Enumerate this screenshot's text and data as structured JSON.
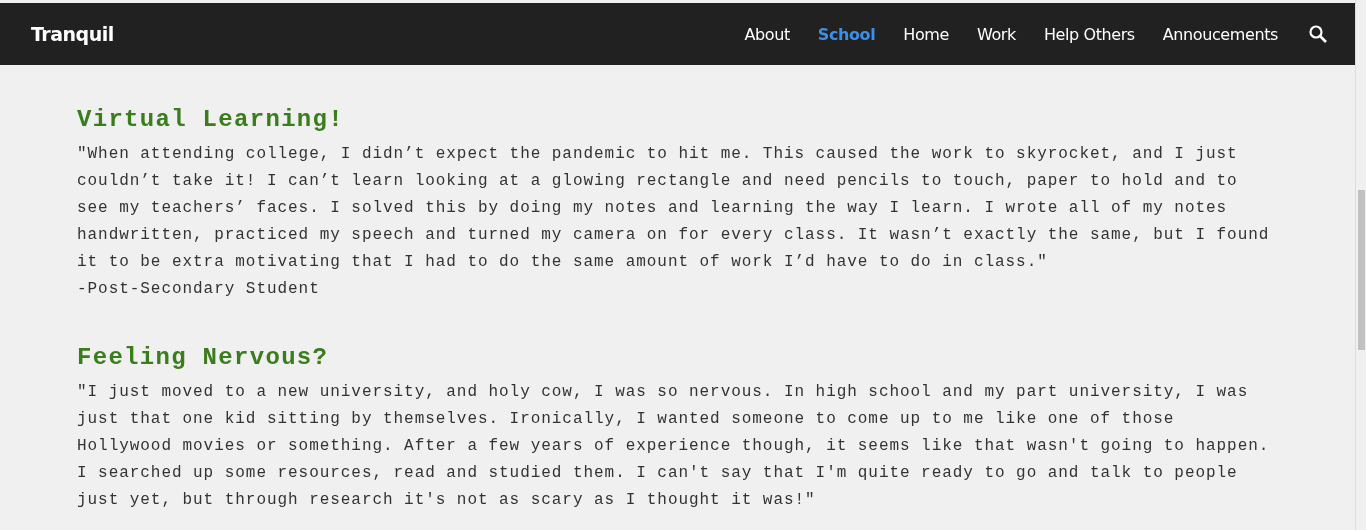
{
  "header": {
    "logo": "Tranquil",
    "nav": [
      {
        "label": "About",
        "selected": false
      },
      {
        "label": "School",
        "selected": true
      },
      {
        "label": "Home",
        "selected": false
      },
      {
        "label": "Work",
        "selected": false
      },
      {
        "label": "Help Others",
        "selected": false
      },
      {
        "label": "Annoucements",
        "selected": false
      }
    ]
  },
  "sections": [
    {
      "title": "Virtual Learning!",
      "quote_lines": [
        "\"When attending college, I didn’t expect the pandemic to hit me. This caused the work to skyrocket, and I just",
        "couldn’t take it! I can’t learn looking at a glowing rectangle and need pencils to touch, paper to hold and to",
        "see my teachers’ faces. I solved this by doing my notes and learning the way I learn. I wrote all of my notes",
        "handwritten, practiced my speech and turned my camera on for every class. It wasn’t exactly the same, but I found",
        "it to be extra motivating that I had to do the same amount of work I’d have to do in class.\""
      ],
      "author": "-Post-Secondary Student"
    },
    {
      "title": "Feeling Nervous?",
      "quote_lines": [
        "\"I just moved to a new university, and holy cow, I was so nervous. In high school and my part university, I was",
        "just that one kid sitting by themselves. Ironically, I wanted someone to come up to me like one of those",
        "Hollywood movies or something. After a few years of experience though, it seems like that wasn't going to happen.",
        "I searched up some resources, read and studied them. I can't say that I'm quite ready to go and talk to people",
        "just yet, but through research it's not as scary as I thought it was!\""
      ]
    }
  ]
}
